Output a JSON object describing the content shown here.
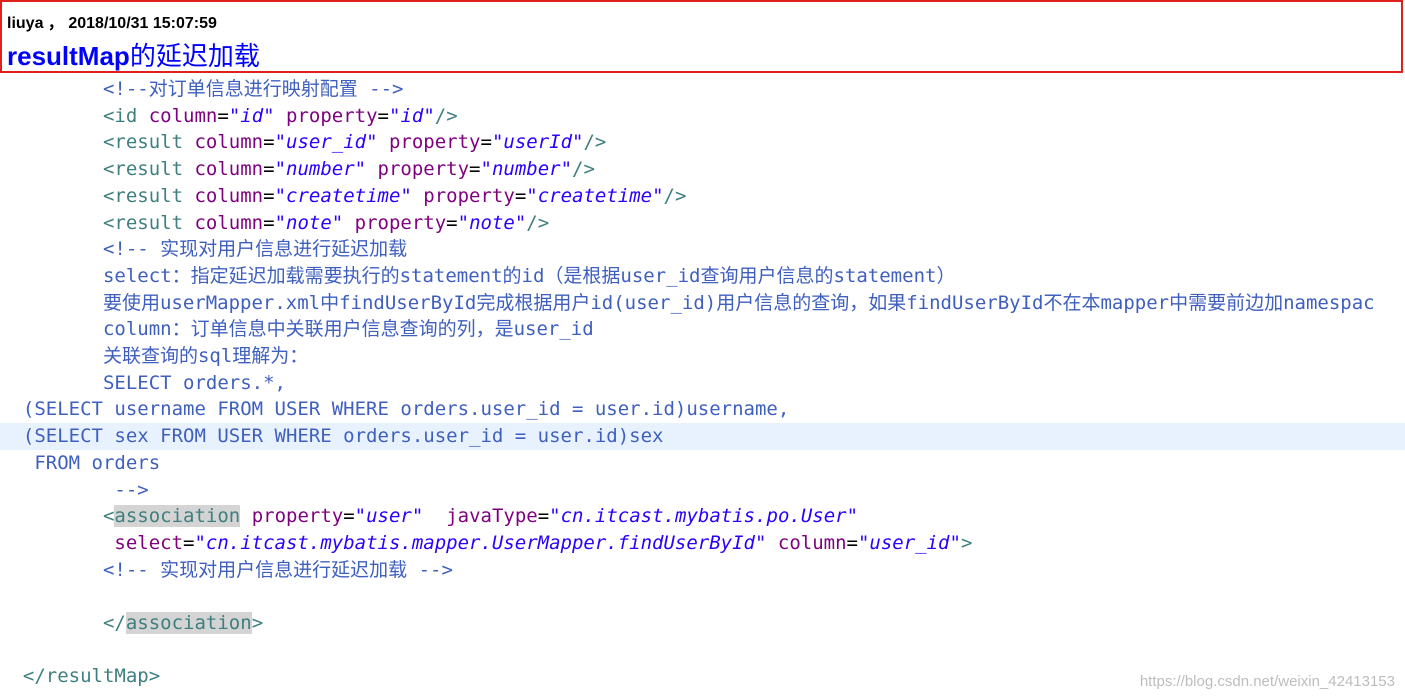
{
  "header": {
    "meta": "liuya ， 2018/10/31 15:07:59",
    "title_en": "resultMap",
    "title_cn": "的延迟加载"
  },
  "code": {
    "l1": "<!--对订单信息进行映射配置 -->",
    "l2_tag_open": "<id ",
    "l2_a1": "column",
    "l2_v1": "\"id\"",
    "l2_a2": "property",
    "l2_v2": "\"id\"",
    "l2_close": "/>",
    "l3_tag": "<result ",
    "l3_a1": "column",
    "l3_v1": "\"user_id\"",
    "l3_a2": "property",
    "l3_v2": "\"userId\"",
    "l4_v1": "\"number\"",
    "l4_v2": "\"number\"",
    "l5_v1": "\"createtime\"",
    "l5_v2": "\"createtime\"",
    "l6_v1": "\"note\"",
    "l6_v2": "\"note\"",
    "l7": "<!-- 实现对用户信息进行延迟加载",
    "l8": "select：指定延迟加载需要执行的statement的id（是根据user_id查询用户信息的statement）",
    "l9": "要使用userMapper.xml中findUserById完成根据用户id(user_id)用户信息的查询，如果findUserById不在本mapper中需要前边加namespac",
    "l10": "column：订单信息中关联用户信息查询的列，是user_id",
    "l11": "关联查询的sql理解为：",
    "l12": "SELECT orders.*,",
    "l13": "(SELECT username FROM USER WHERE orders.user_id = user.id)username,",
    "l14": "(SELECT sex FROM USER WHERE orders.user_id = user.id)sex",
    "l15": "FROM orders",
    "l16": "-->",
    "l17_open": "<",
    "l17_tag": "association",
    "l17_a1": "property",
    "l17_v1": "\"user\"",
    "l17_a2": "javaType",
    "l17_v2": "\"cn.itcast.mybatis.po.User\"",
    "l18_a1": "select",
    "l18_v1": "\"cn.itcast.mybatis.mapper.UserMapper.findUserById\"",
    "l18_a2": "column",
    "l18_v2": "\"user_id\"",
    "l18_close": ">",
    "l19": "<!-- 实现对用户信息进行延迟加载 -->",
    "l21_open": "</",
    "l21_tag": "association",
    "l21_close": ">",
    "l23": "</resultMap>",
    "eq": "=",
    "result_tag": "<result ",
    "self_close": "/>"
  },
  "watermark": "https://blog.csdn.net/weixin_42413153"
}
